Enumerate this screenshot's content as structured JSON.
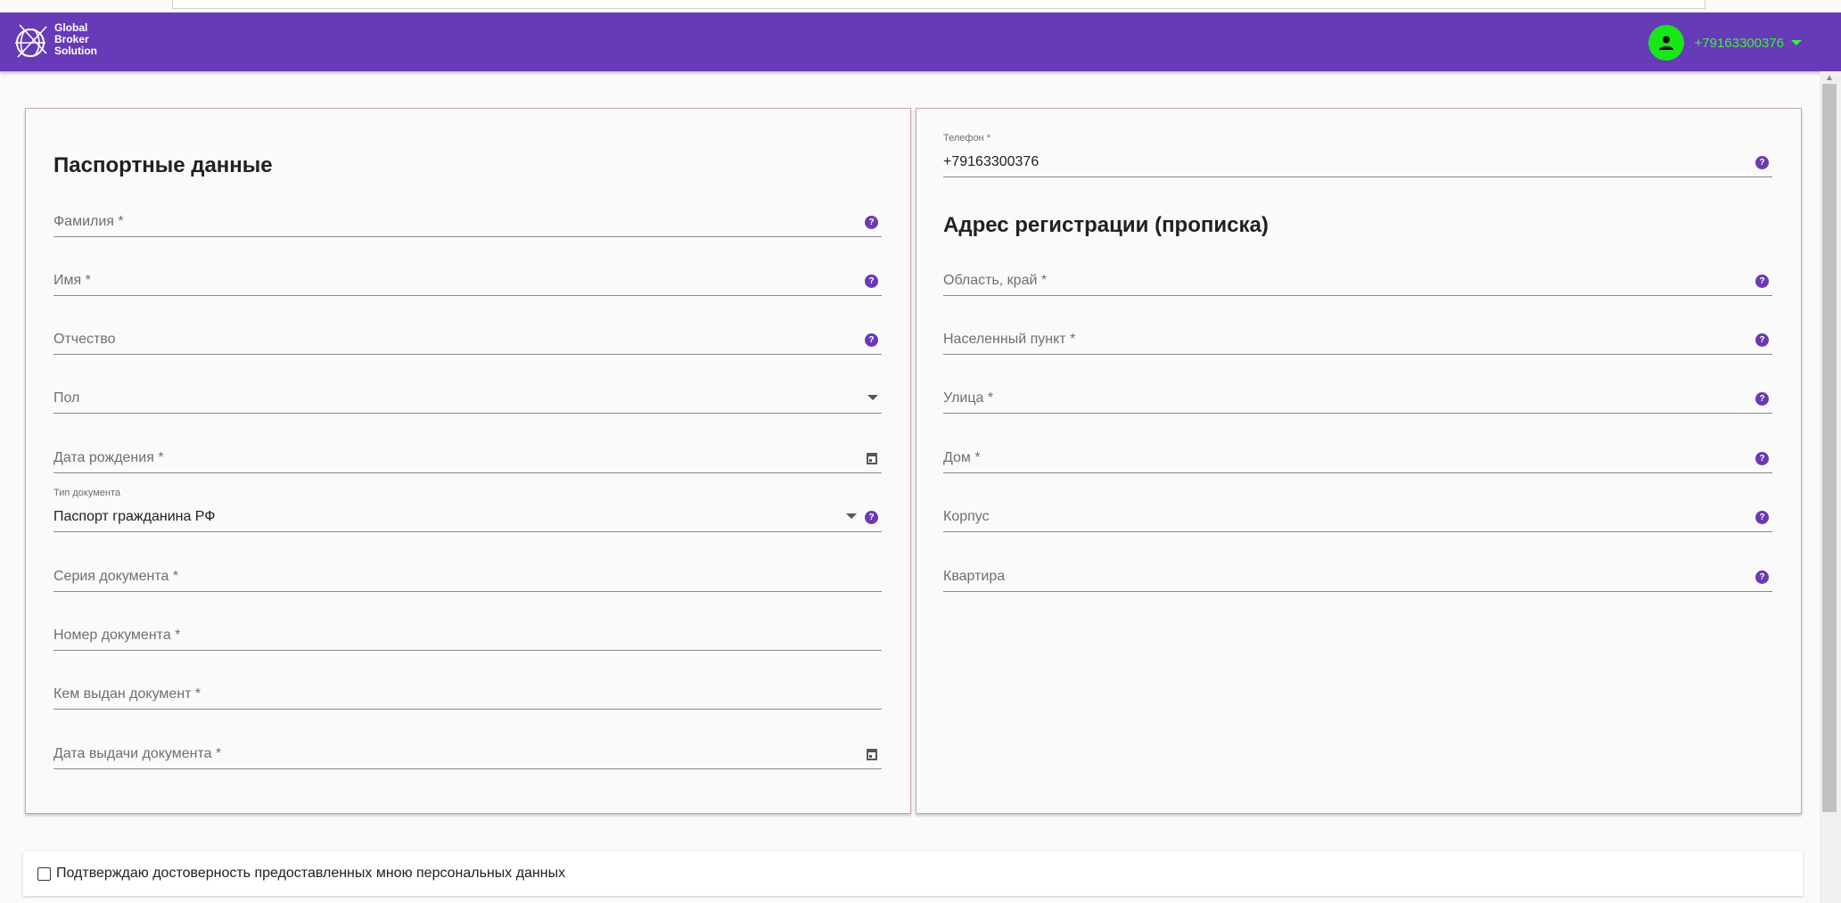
{
  "header": {
    "logo_lines": [
      "Global",
      "Broker",
      "Solution"
    ],
    "user_phone": "+79163300376"
  },
  "passport": {
    "title": "Паспортные данные",
    "fields": {
      "last_name": "Фамилия *",
      "first_name": "Имя *",
      "patronymic": "Отчество",
      "gender": "Пол",
      "birth_date": "Дата рождения *",
      "doc_type_label": "Тип документа",
      "doc_type_value": "Паспорт гражданина РФ",
      "doc_series": "Серия документа *",
      "doc_number": "Номер документа *",
      "issued_by": "Кем выдан документ *",
      "issue_date": "Дата выдачи документа *"
    }
  },
  "contact": {
    "phone_label": "Телефон *",
    "phone_value": "+79163300376"
  },
  "address": {
    "title": "Адрес регистрации (прописка)",
    "fields": {
      "region": "Область, край *",
      "locality": "Населенный пункт *",
      "street": "Улица *",
      "house": "Дом *",
      "building": "Корпус",
      "apartment": "Квартира"
    }
  },
  "confirm": {
    "label": "Подтверждаю достоверность предоставленных мною персональных данных",
    "checked": false
  },
  "colors": {
    "appbar": "#673ab7",
    "accent_help": "#6a3ab2",
    "user_online": "#19e619"
  },
  "icons": {
    "help": "question-circle-icon",
    "calendar": "calendar-icon",
    "dropdown": "caret-down-icon",
    "avatar": "person-icon"
  }
}
